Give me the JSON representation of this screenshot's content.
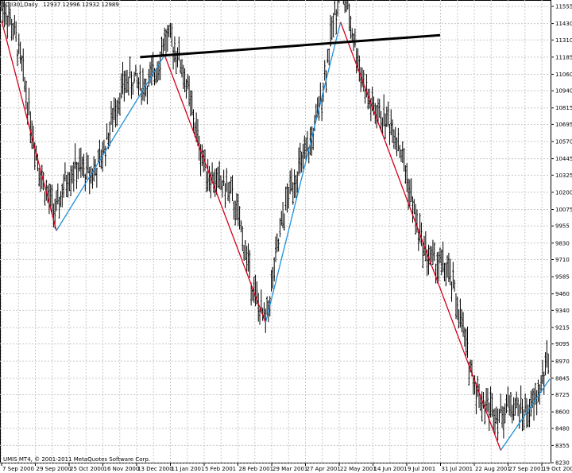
{
  "header": {
    "symbol": "[DJI30],Daily",
    "quote": "12937 12996 12932 12989"
  },
  "footer": {
    "copyright": "UMIS MT4, © 2001-2011 MetaQuotes Software Corp."
  },
  "colors": {
    "background": "#ffffff",
    "grid": "#c8c8c8",
    "bars": "#000000",
    "zigzag_down": "#d4001c",
    "zigzag_up": "#1e8fd8",
    "trendline": "#000000"
  },
  "chart_data": {
    "type": "line",
    "x_ticks": [
      "7 Sep 2000",
      "29 Sep 2000",
      "25 Oct 2000",
      "16 Nov 2000",
      "13 Dec 2000",
      "11 Jan 2001",
      "5 Feb 2001",
      "28 Feb 2001",
      "29 Mar 2001",
      "27 Apr 2001",
      "22 May 2001",
      "14 Jun 2001",
      "9 Jul 2001",
      "31 Jul 2001",
      "22 Aug 2001",
      "27 Sep 2001",
      "19 Oct 2001"
    ],
    "y_ticks": [
      11555,
      11430,
      11310,
      11185,
      11060,
      10940,
      10815,
      10695,
      10570,
      10445,
      10325,
      10200,
      10075,
      9955,
      9830,
      9710,
      9585,
      9460,
      9340,
      9215,
      9095,
      8970,
      8845,
      8725,
      8600,
      8480,
      8355,
      8230
    ],
    "ylim": [
      8230,
      11580
    ],
    "zigzag": [
      {
        "x": 0,
        "y": 11450
      },
      {
        "x": 38,
        "y": 9920
      },
      {
        "x": 113,
        "y": 11200
      },
      {
        "x": 183,
        "y": 9250
      },
      {
        "x": 235,
        "y": 11440
      },
      {
        "x": 346,
        "y": 8320
      },
      {
        "x": 380,
        "y": 8840
      }
    ],
    "trendline": [
      {
        "x": 96,
        "y": 11185
      },
      {
        "x": 304,
        "y": 11345
      }
    ],
    "bar_count": 380,
    "grid": true
  }
}
